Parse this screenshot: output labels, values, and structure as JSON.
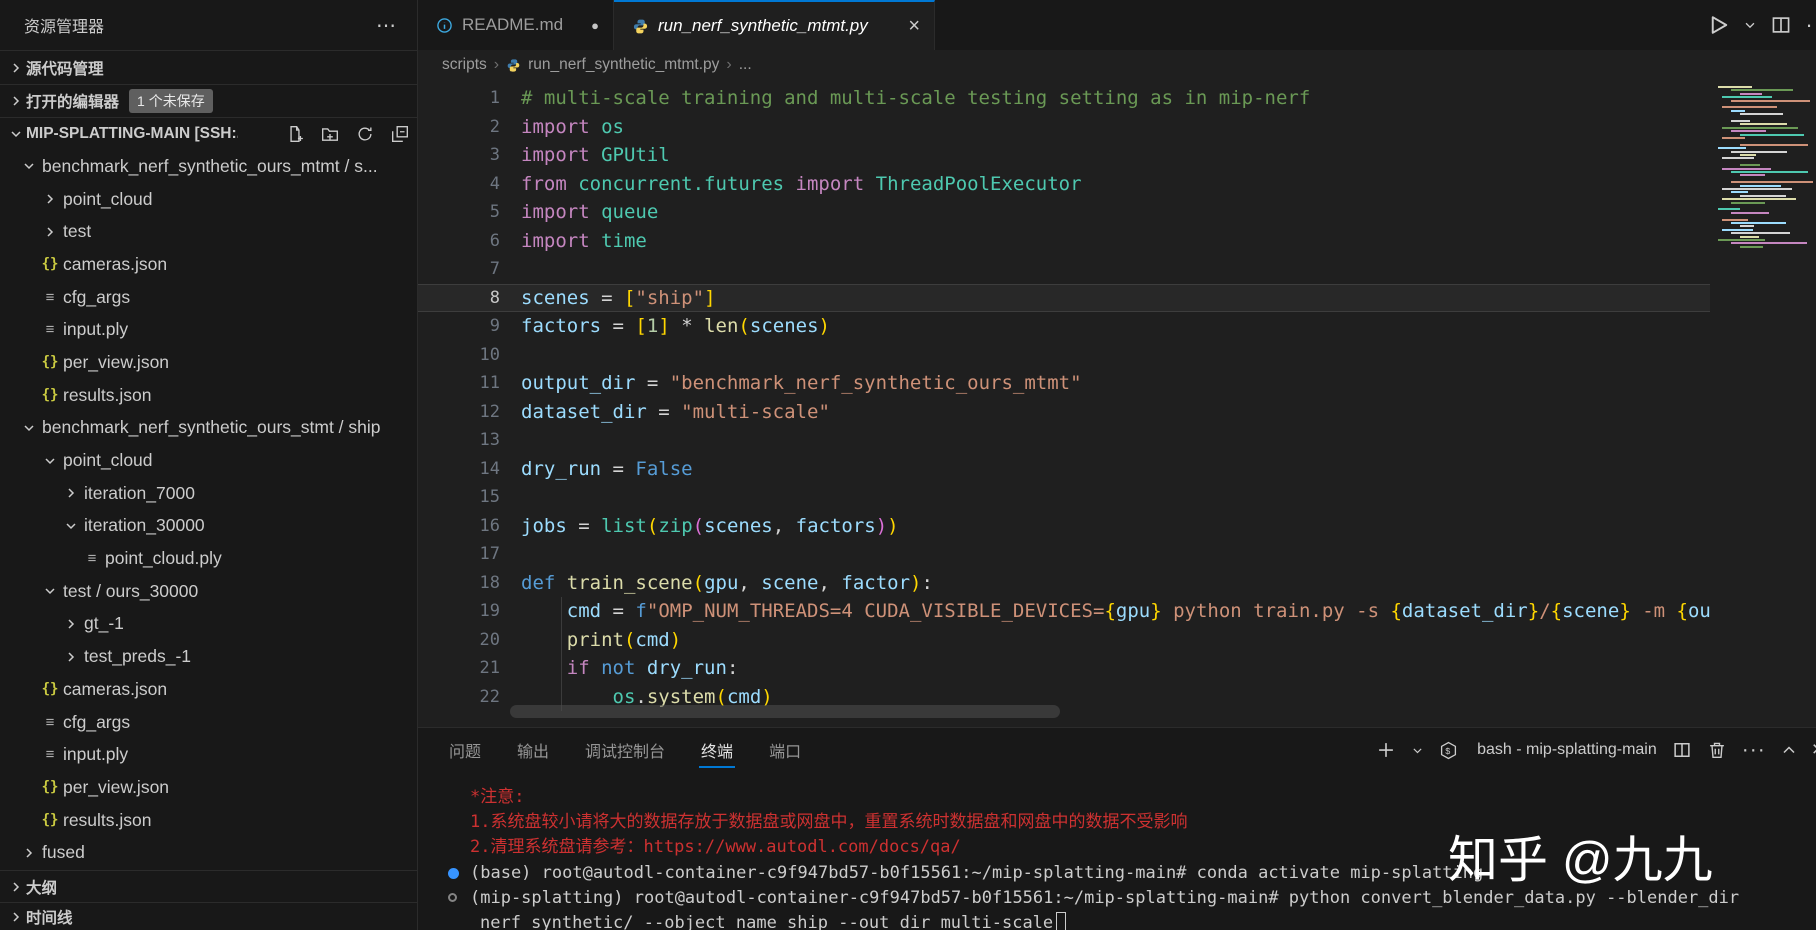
{
  "sidebar": {
    "title": "资源管理器",
    "more_icon": "⋯",
    "sections": {
      "source_control": "源代码管理",
      "open_editors": "打开的编辑器",
      "open_editors_badge": "1 个未保存",
      "workspace": "MIP-SPLATTING-MAIN [SSH:...",
      "outline": "大纲",
      "timeline": "时间线"
    },
    "tree": [
      {
        "label": "benchmark_nerf_synthetic_ours_mtmt / s...",
        "level": 0,
        "kind": "folder",
        "expanded": true
      },
      {
        "label": "point_cloud",
        "level": 1,
        "kind": "folder",
        "expanded": false
      },
      {
        "label": "test",
        "level": 1,
        "kind": "folder",
        "expanded": false
      },
      {
        "label": "cameras.json",
        "level": 1,
        "kind": "json"
      },
      {
        "label": "cfg_args",
        "level": 1,
        "kind": "file"
      },
      {
        "label": "input.ply",
        "level": 1,
        "kind": "file"
      },
      {
        "label": "per_view.json",
        "level": 1,
        "kind": "json"
      },
      {
        "label": "results.json",
        "level": 1,
        "kind": "json"
      },
      {
        "label": "benchmark_nerf_synthetic_ours_stmt / ship",
        "level": 0,
        "kind": "folder",
        "expanded": true
      },
      {
        "label": "point_cloud",
        "level": 1,
        "kind": "folder",
        "expanded": true
      },
      {
        "label": "iteration_7000",
        "level": 2,
        "kind": "folder",
        "expanded": false
      },
      {
        "label": "iteration_30000",
        "level": 2,
        "kind": "folder",
        "expanded": true
      },
      {
        "label": "point_cloud.ply",
        "level": 3,
        "kind": "file"
      },
      {
        "label": "test / ours_30000",
        "level": 1,
        "kind": "folder",
        "expanded": true
      },
      {
        "label": "gt_-1",
        "level": 2,
        "kind": "folder",
        "expanded": false
      },
      {
        "label": "test_preds_-1",
        "level": 2,
        "kind": "folder",
        "expanded": false
      },
      {
        "label": "cameras.json",
        "level": 1,
        "kind": "json"
      },
      {
        "label": "cfg_args",
        "level": 1,
        "kind": "file"
      },
      {
        "label": "input.ply",
        "level": 1,
        "kind": "file"
      },
      {
        "label": "per_view.json",
        "level": 1,
        "kind": "json"
      },
      {
        "label": "results.json",
        "level": 1,
        "kind": "json"
      },
      {
        "label": "fused",
        "level": 0,
        "kind": "folder",
        "expanded": false
      }
    ]
  },
  "tabs": [
    {
      "label": "README.md",
      "modified": true,
      "active": false
    },
    {
      "label": "run_nerf_synthetic_mtmt.py",
      "modified": false,
      "active": true
    }
  ],
  "breadcrumb": {
    "root": "scripts",
    "file": "run_nerf_synthetic_mtmt.py",
    "more": "..."
  },
  "editor": {
    "current_line": 8,
    "lines": [
      {
        "n": 1,
        "tokens": [
          [
            "com",
            "# multi-scale training and multi-scale testing setting as in mip-nerf"
          ]
        ]
      },
      {
        "n": 2,
        "tokens": [
          [
            "kw",
            "import "
          ],
          [
            "cls",
            "os"
          ]
        ]
      },
      {
        "n": 3,
        "tokens": [
          [
            "kw",
            "import "
          ],
          [
            "cls",
            "GPUtil"
          ]
        ]
      },
      {
        "n": 4,
        "tokens": [
          [
            "kw",
            "from "
          ],
          [
            "cls",
            "concurrent.futures "
          ],
          [
            "kw",
            "import "
          ],
          [
            "cls",
            "ThreadPoolExecutor"
          ]
        ]
      },
      {
        "n": 5,
        "tokens": [
          [
            "kw",
            "import "
          ],
          [
            "cls",
            "queue"
          ]
        ]
      },
      {
        "n": 6,
        "tokens": [
          [
            "kw",
            "import "
          ],
          [
            "cls",
            "time"
          ]
        ]
      },
      {
        "n": 7,
        "tokens": []
      },
      {
        "n": 8,
        "tokens": [
          [
            "var",
            "scenes"
          ],
          [
            "op",
            " = "
          ],
          [
            "b1",
            "["
          ],
          [
            "str",
            "\"ship\""
          ],
          [
            "b1",
            "]"
          ]
        ]
      },
      {
        "n": 9,
        "tokens": [
          [
            "var",
            "factors"
          ],
          [
            "op",
            " = "
          ],
          [
            "b1",
            "["
          ],
          [
            "num",
            "1"
          ],
          [
            "b1",
            "]"
          ],
          [
            "op",
            " * "
          ],
          [
            "fn",
            "len"
          ],
          [
            "b1",
            "("
          ],
          [
            "var",
            "scenes"
          ],
          [
            "b1",
            ")"
          ]
        ]
      },
      {
        "n": 10,
        "tokens": []
      },
      {
        "n": 11,
        "tokens": [
          [
            "var",
            "output_dir"
          ],
          [
            "op",
            " = "
          ],
          [
            "str",
            "\"benchmark_nerf_synthetic_ours_mtmt\""
          ]
        ]
      },
      {
        "n": 12,
        "tokens": [
          [
            "var",
            "dataset_dir"
          ],
          [
            "op",
            " = "
          ],
          [
            "str",
            "\"multi-scale\""
          ]
        ]
      },
      {
        "n": 13,
        "tokens": []
      },
      {
        "n": 14,
        "tokens": [
          [
            "var",
            "dry_run"
          ],
          [
            "op",
            " = "
          ],
          [
            "kb",
            "False"
          ]
        ]
      },
      {
        "n": 15,
        "tokens": []
      },
      {
        "n": 16,
        "tokens": [
          [
            "var",
            "jobs"
          ],
          [
            "op",
            " = "
          ],
          [
            "cls",
            "list"
          ],
          [
            "b1",
            "("
          ],
          [
            "cls",
            "zip"
          ],
          [
            "b2",
            "("
          ],
          [
            "var",
            "scenes"
          ],
          [
            "op",
            ", "
          ],
          [
            "var",
            "factors"
          ],
          [
            "b2",
            ")"
          ],
          [
            "b1",
            ")"
          ]
        ]
      },
      {
        "n": 17,
        "tokens": []
      },
      {
        "n": 18,
        "tokens": [
          [
            "kb",
            "def "
          ],
          [
            "fn",
            "train_scene"
          ],
          [
            "b1",
            "("
          ],
          [
            "var",
            "gpu"
          ],
          [
            "op",
            ", "
          ],
          [
            "var",
            "scene"
          ],
          [
            "op",
            ", "
          ],
          [
            "var",
            "factor"
          ],
          [
            "b1",
            ")"
          ],
          [
            "op",
            ":"
          ]
        ]
      },
      {
        "n": 19,
        "tokens": [
          [
            "ws",
            "    "
          ],
          [
            "var",
            "cmd"
          ],
          [
            "op",
            " = "
          ],
          [
            "kb",
            "f"
          ],
          [
            "str",
            "\"OMP_NUM_THREADS=4 CUDA_VISIBLE_DEVICES="
          ],
          [
            "b1",
            "{"
          ],
          [
            "var",
            "gpu"
          ],
          [
            "b1",
            "}"
          ],
          [
            "str",
            " python train.py -s "
          ],
          [
            "b1",
            "{"
          ],
          [
            "var",
            "dataset_dir"
          ],
          [
            "b1",
            "}"
          ],
          [
            "str",
            "/"
          ],
          [
            "b1",
            "{"
          ],
          [
            "var",
            "scene"
          ],
          [
            "b1",
            "}"
          ],
          [
            "str",
            " -m "
          ],
          [
            "b1",
            "{"
          ],
          [
            "var",
            "ou"
          ]
        ]
      },
      {
        "n": 20,
        "tokens": [
          [
            "ws",
            "    "
          ],
          [
            "fn",
            "print"
          ],
          [
            "b1",
            "("
          ],
          [
            "var",
            "cmd"
          ],
          [
            "b1",
            ")"
          ]
        ]
      },
      {
        "n": 21,
        "tokens": [
          [
            "ws",
            "    "
          ],
          [
            "kw",
            "if "
          ],
          [
            "kb",
            "not "
          ],
          [
            "var",
            "dry_run"
          ],
          [
            "op",
            ":"
          ]
        ]
      },
      {
        "n": 22,
        "tokens": [
          [
            "ws",
            "        "
          ],
          [
            "cls",
            "os"
          ],
          [
            "op",
            "."
          ],
          [
            "fn",
            "system"
          ],
          [
            "b1",
            "("
          ],
          [
            "var",
            "cmd"
          ],
          [
            "b1",
            ")"
          ]
        ]
      }
    ]
  },
  "panel": {
    "tabs": [
      {
        "label": "问题",
        "active": false
      },
      {
        "label": "输出",
        "active": false
      },
      {
        "label": "调试控制台",
        "active": false
      },
      {
        "label": "终端",
        "active": true
      },
      {
        "label": "端口",
        "active": false
      }
    ],
    "terminal_label": "bash - mip-splatting-main"
  },
  "terminal": {
    "lines": [
      {
        "style": "red",
        "text": "*注意:"
      },
      {
        "style": "red",
        "text": "1.系统盘较小请将大的数据存放于数据盘或网盘中，重置系统时数据盘和网盘中的数据不受影响"
      },
      {
        "style": "red",
        "text": "2.清理系统盘请参考：https://www.autodl.com/docs/qa/"
      },
      {
        "style": "norm",
        "bullet": "blue",
        "text": "(base) root@autodl-container-c9f947bd57-b0f15561:~/mip-splatting-main# conda activate mip-splatting"
      },
      {
        "style": "norm",
        "bullet": "gray",
        "text": "(mip-splatting) root@autodl-container-c9f947bd57-b0f15561:~/mip-splatting-main# python convert_blender_data.py --blender_dir"
      },
      {
        "style": "norm",
        "indent": true,
        "cursor": true,
        "text": "nerf_synthetic/ --object_name ship --out_dir multi-scale"
      }
    ]
  },
  "watermark": {
    "text": "知乎 @九九"
  },
  "colors": {
    "accent": "#0078d4",
    "terminal_red": "#cd3131",
    "bullet_blue": "#3794ff",
    "sidebar_bg": "#181818",
    "editor_bg": "#1f1f1f"
  }
}
